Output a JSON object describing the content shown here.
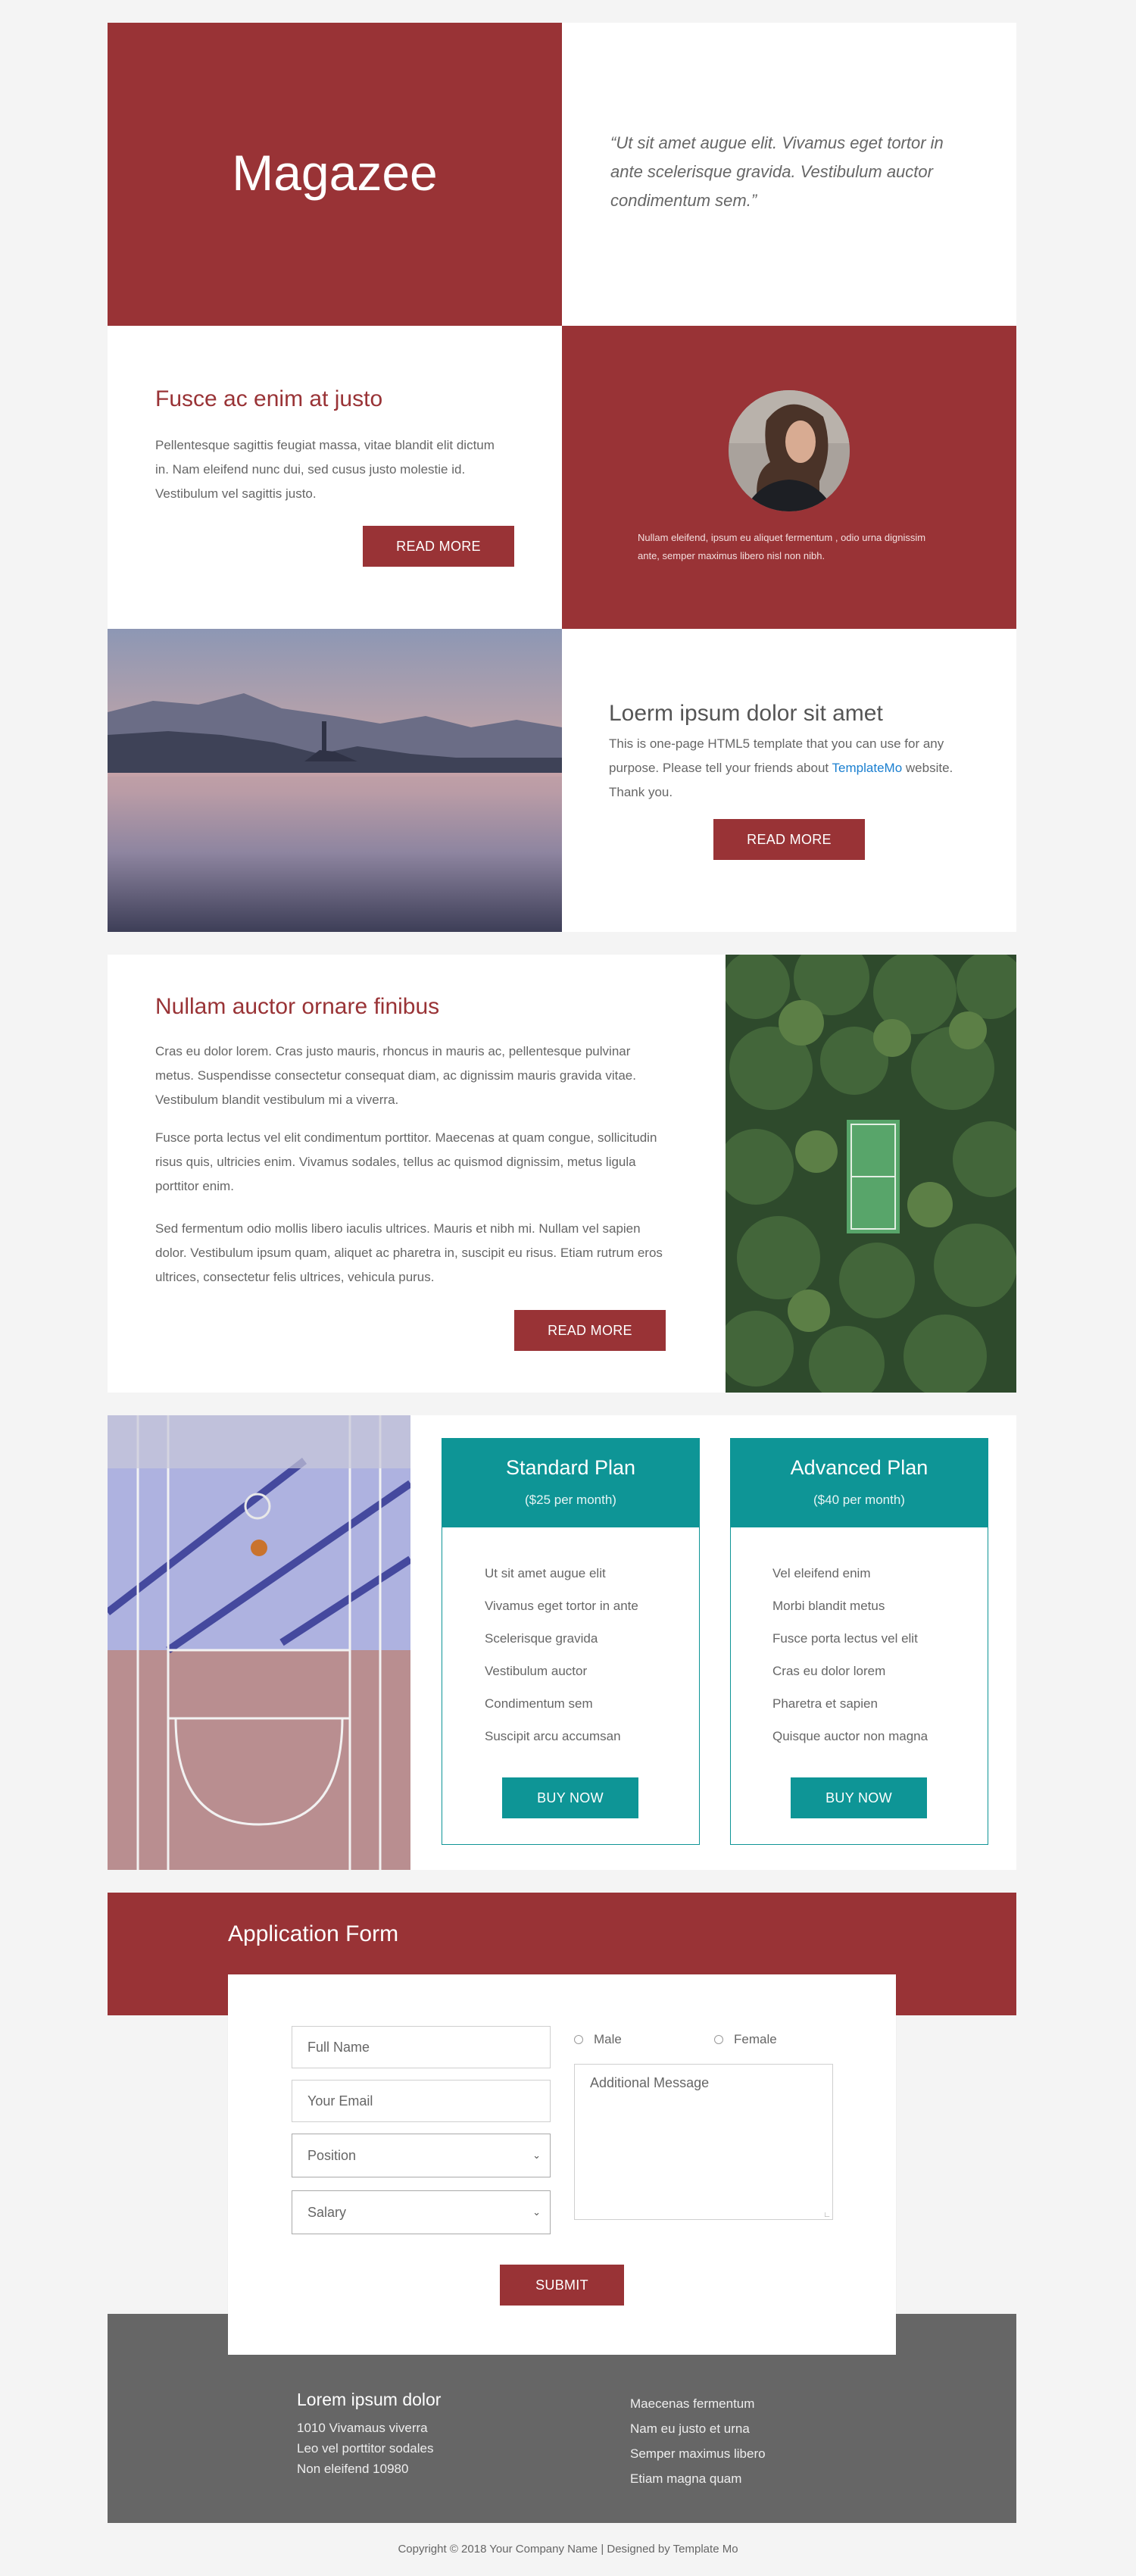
{
  "hero": {
    "brand": "Magazee",
    "quote": "“Ut sit amet augue elit. Vivamus eget tortor in ante scelerisque gravida. Vestibulum auctor condimentum sem.”"
  },
  "section1": {
    "title": "Fusce ac enim at justo",
    "body": "Pellentesque sagittis feugiat massa, vitae blandit elit dictum in. Nam eleifend nunc dui, sed cusus justo molestie id. Vestibulum vel sagittis justo.",
    "button": "READ MORE"
  },
  "profile": {
    "caption": "Nullam eleifend, ipsum eu aliquet fermentum , odio urna dignissim ante, semper maximus libero nisl non nibh."
  },
  "section2": {
    "title": "Loerm ipsum dolor sit amet",
    "body_pre": "This is one-page HTML5 template that you can use for any purpose. Please tell your friends about ",
    "link": "TemplateMo",
    "body_post": " website. Thank you.",
    "button": "READ MORE"
  },
  "section3": {
    "title": "Nullam auctor ornare finibus",
    "p1": "Cras eu dolor lorem. Cras justo mauris, rhoncus in mauris ac, pellentesque pulvinar metus. Suspendisse consectetur consequat diam, ac dignissim mauris gravida vitae. Vestibulum blandit vestibulum mi a viverra.",
    "p2": "Fusce porta lectus vel elit condimentum porttitor. Maecenas at quam congue, sollicitudin risus quis, ultricies enim. Vivamus sodales, tellus ac quismod dignissim, metus ligula porttitor enim.",
    "p3": "Sed fermentum odio mollis libero iaculis ultrices. Mauris et nibh mi. Nullam vel sapien dolor. Vestibulum ipsum quam, aliquet ac pharetra in, suscipit eu risus. Etiam rutrum eros ultrices, consectetur felis ultrices, vehicula purus.",
    "button": "READ MORE"
  },
  "plans": [
    {
      "name": "Standard Plan",
      "price": "($25 per month)",
      "features": [
        "Ut sit amet augue elit",
        "Vivamus eget tortor in ante",
        "Scelerisque gravida",
        "Vestibulum auctor",
        "Condimentum sem",
        "Suscipit arcu accumsan"
      ],
      "button": "BUY NOW"
    },
    {
      "name": "Advanced Plan",
      "price": "($40 per month)",
      "features": [
        "Vel eleifend enim",
        "Morbi blandit metus",
        "Fusce porta lectus vel elit",
        "Cras eu dolor lorem",
        "Pharetra et sapien",
        "Quisque auctor non magna"
      ],
      "button": "BUY NOW"
    }
  ],
  "form": {
    "title": "Application Form",
    "full_name": "Full Name",
    "email": "Your Email",
    "position": "Position",
    "salary": "Salary",
    "male": "Male",
    "female": "Female",
    "message": "Additional Message",
    "submit": "SUBMIT"
  },
  "footer": {
    "heading": "Lorem ipsum dolor",
    "address": [
      "1010 Vivamaus viverra",
      "Leo vel porttitor sodales",
      "Non eleifend 10980"
    ],
    "links": [
      "Maecenas fermentum",
      "Nam eu justo et urna",
      "Semper maximus libero",
      "Etiam magna quam"
    ],
    "copyright": "Copyright © 2018 Your Company Name | Designed by Template Mo"
  },
  "colors": {
    "accent": "#993336",
    "teal": "#0e9596",
    "footer_bg": "#666666",
    "link": "#1a7fd0"
  }
}
